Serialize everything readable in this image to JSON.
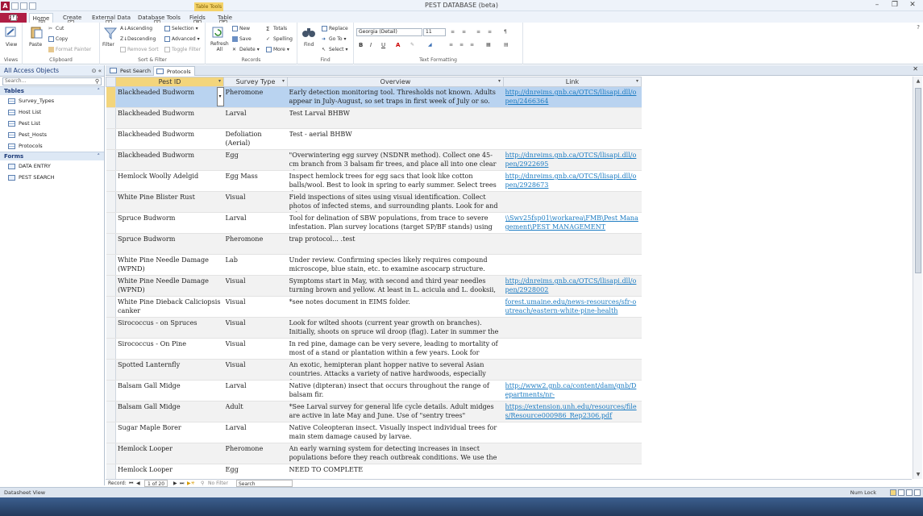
{
  "app": {
    "title": "PEST DATABASE (beta)",
    "context_tab_group": "Table Tools",
    "logo_letter": "A"
  },
  "ribbon_tabs": [
    {
      "label": "File",
      "key": "F"
    },
    {
      "label": "Home",
      "key": "H"
    },
    {
      "label": "Create",
      "key": "C"
    },
    {
      "label": "External Data",
      "key": "X"
    },
    {
      "label": "Database Tools",
      "key": "Y"
    },
    {
      "label": "Fields",
      "key": "JB"
    },
    {
      "label": "Table",
      "key": "JT"
    }
  ],
  "ribbon": {
    "views": {
      "view_label": "View",
      "group_label": "Views"
    },
    "clipboard": {
      "paste_label": "Paste",
      "cut_label": "Cut",
      "copy_label": "Copy",
      "format_painter_label": "Format Painter",
      "group_label": "Clipboard"
    },
    "sort_filter": {
      "filter_label": "Filter",
      "ascending_label": "Ascending",
      "descending_label": "Descending",
      "remove_sort_label": "Remove Sort",
      "selection_label": "Selection",
      "advanced_label": "Advanced",
      "toggle_filter_label": "Toggle Filter",
      "group_label": "Sort & Filter"
    },
    "records": {
      "refresh_label": "Refresh All",
      "new_label": "New",
      "save_label": "Save",
      "delete_label": "Delete",
      "totals_label": "Totals",
      "spelling_label": "Spelling",
      "more_label": "More",
      "group_label": "Records"
    },
    "find": {
      "find_label": "Find",
      "replace_label": "Replace",
      "goto_label": "Go To",
      "select_label": "Select",
      "group_label": "Find"
    },
    "text_formatting": {
      "font_value": "Georgia (Detail)",
      "size_value": "11",
      "bold": "B",
      "italic": "I",
      "underline": "U",
      "group_label": "Text Formatting"
    }
  },
  "nav_pane": {
    "title": "All Access Objects",
    "search_placeholder": "Search...",
    "sections": [
      {
        "label": "Tables",
        "items": [
          "Survey_Types",
          "Host List",
          "Pest List",
          "Pest_Hosts",
          "Protocols"
        ]
      },
      {
        "label": "Forms",
        "items": [
          "DATA ENTRY",
          "PEST SEARCH"
        ]
      }
    ]
  },
  "doc_tabs": [
    {
      "label": "Pest Search",
      "active": false
    },
    {
      "label": "Protocols",
      "active": true
    }
  ],
  "datasheet": {
    "columns": [
      "Pest ID",
      "Survey Type",
      "Overview",
      "Link"
    ],
    "rows": [
      {
        "pest": "Blackheaded Budworm",
        "survey": "Pheromone",
        "overview": "Early detection monitoring tool. Thresholds not known. Adults appear in July-August, so set traps in first week of July or so. Use",
        "link": "http://dnreims.gnb.ca/OTCS/llisapi.dll/open/2466364"
      },
      {
        "pest": "Blackheaded Budworm",
        "survey": "Larval",
        "overview": "Test Larval BHBW",
        "link": ""
      },
      {
        "pest": "Blackheaded Budworm",
        "survey": "Defoliation (Aerial)",
        "overview": "Test - aerial BHBW",
        "link": ""
      },
      {
        "pest": "Blackheaded Budworm",
        "survey": "Egg",
        "overview": "\"Overwintering egg survey (NSDNR method). Collect one 45-cm branch from 3 balsam fir trees, and place all into one clear plastic",
        "link": "http://dnreims.gnb.ca/OTCS/llisapi.dll/open/2922695"
      },
      {
        "pest": "Hemlock Woolly Adelgid",
        "survey": "Egg Mass",
        "overview": "Inspect hemlock trees for egg sacs that look like cotton balls/wool. Best to look in spring to early summer. Select trees that are mature",
        "link": "http://dnreims.gnb.ca/OTCS/llisapi.dll/open/2928673"
      },
      {
        "pest": "White Pine Blister Rust",
        "survey": "Visual",
        "overview": "Field inspections of sites using visual identification. Collect photos of infected stems, and surrounding plants. Look for and take note",
        "link": ""
      },
      {
        "pest": "Spruce Budworm",
        "survey": "Larval",
        "overview": "Tool for delination of SBW populations, from trace to severe infestation. Plan survey locations (target SP/BF stands) using GIS.",
        "link": "\\\\Swv25fsp01\\workarea\\FMB\\Pest Management\\PEST MANAGEMENT"
      },
      {
        "pest": "Spruce Budworm",
        "survey": "Pheromone",
        "overview": "trap protocol... .test",
        "link": ""
      },
      {
        "pest": "White Pine Needle Damage (WPND)",
        "survey": "Lab",
        "overview": "Under review. Confirming species likely requires compound microscope, blue stain, etc. to examine ascocarp structure.",
        "link": ""
      },
      {
        "pest": "White Pine Needle Damage (WPND)",
        "survey": "Visual",
        "overview": "Symptoms start in May, with second and third year needles turning brown and yellow. At least in L. acicula and L. dooksii,",
        "link": "http://dnreims.gnb.ca/OTCS/llisapi.dll/open/2928002"
      },
      {
        "pest": "White Pine Dieback Caliciopsis canker",
        "survey": "Visual",
        "overview": "*see notes document in EIMS folder.",
        "link": "forest.umaine.edu/news-resources/sfr-outreach/eastern-white-pine-health"
      },
      {
        "pest": "Sirococcus - on Spruces",
        "survey": "Visual",
        "overview": "Look for wilted shoots (current year growth on branches). Initially, shoots on spruce wil droop (flag). Later in summer the",
        "link": ""
      },
      {
        "pest": "Sirococcus - On Pine",
        "survey": "Visual",
        "overview": "In red pine, damage can be very severe, leading to mortality of most of a stand or plantation within a few years. Look for",
        "link": ""
      },
      {
        "pest": "Spotted Lanternfly",
        "survey": "Visual",
        "overview": "An exotic, hemipteran plant hopper native to several Asian countries. Attacks a variety of native hardwoods, especially fruit",
        "link": ""
      },
      {
        "pest": "Balsam Gall Midge",
        "survey": "Larval",
        "overview": "Native (dipteran) insect that occurs throughout the range of balsam fir.",
        "link": "http://www2.gnb.ca/content/dam/gnb/Departments/nr-"
      },
      {
        "pest": "Balsam Gall Midge",
        "survey": "Adult",
        "overview": "*See Larval survey for general life cycle details. Adult midges are active in late May and June. Use of \"sentry trees\"",
        "link": "https://extension.unh.edu/resources/files/Resource000986_Rep2306.pdf"
      },
      {
        "pest": "Sugar Maple Borer",
        "survey": "Larval",
        "overview": "Native Coleopteran insect. Visually inspect individual trees for main stem damage caused by larvae.",
        "link": ""
      },
      {
        "pest": "Hemlock Looper",
        "survey": "Pheromone",
        "overview": "An early warning system for detecting increases in insect populations before they reach outbreak conditions. We use the",
        "link": ""
      },
      {
        "pest": "Hemlock Looper",
        "survey": "Egg",
        "overview": "NEED TO COMPLETE",
        "link": ""
      }
    ]
  },
  "record_nav": {
    "label": "Record:",
    "position": "1 of 20",
    "filter_label": "No Filter",
    "search_label": "Search"
  },
  "status": {
    "left": "Datasheet View",
    "right": "Num Lock"
  }
}
